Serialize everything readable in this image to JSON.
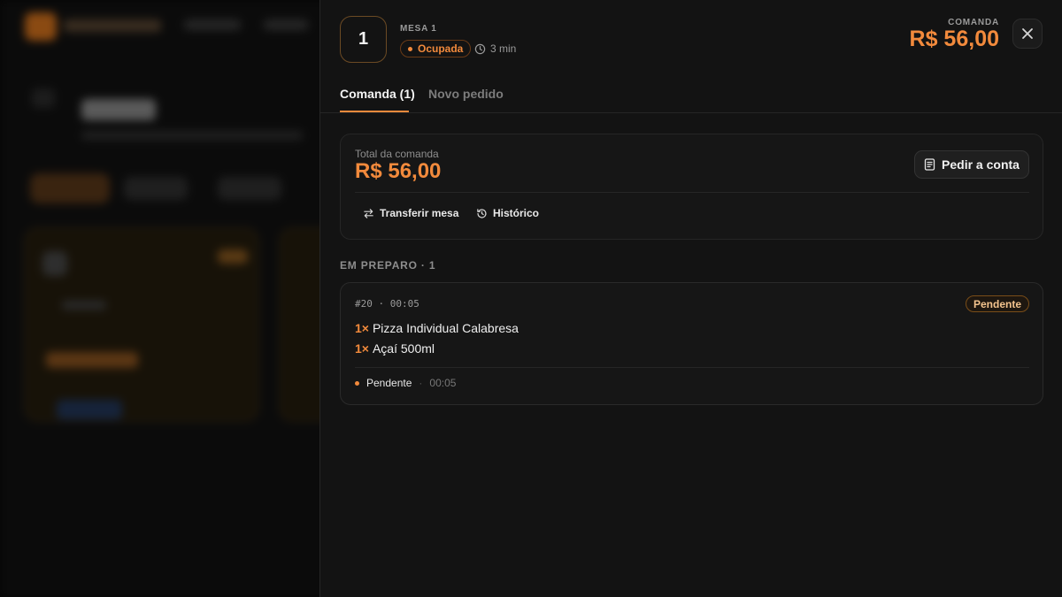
{
  "header": {
    "table_number": "1",
    "table_label": "MESA 1",
    "status": "Ocupada",
    "elapsed": "3 min",
    "comanda_label": "COMANDA",
    "comanda_total": "R$ 56,00",
    "accent_color": "#f28a3c"
  },
  "tabs": [
    {
      "label": "Comanda (1)",
      "active": true
    },
    {
      "label": "Novo pedido",
      "active": false
    }
  ],
  "summary": {
    "label": "Total da comanda",
    "total": "R$ 56,00",
    "bill_button": "Pedir a conta",
    "transfer_link": "Transferir mesa",
    "history_link": "Histórico"
  },
  "section": {
    "title": "EM PREPARO · 1"
  },
  "orders": [
    {
      "meta": "#20 · 00:05",
      "badge": "Pendente",
      "items": [
        {
          "qty": "1×",
          "name": "Pizza Individual Calabresa"
        },
        {
          "qty": "1×",
          "name": "Açaí 500ml"
        }
      ],
      "footer_status": "Pendente",
      "footer_time": "00:05"
    }
  ]
}
